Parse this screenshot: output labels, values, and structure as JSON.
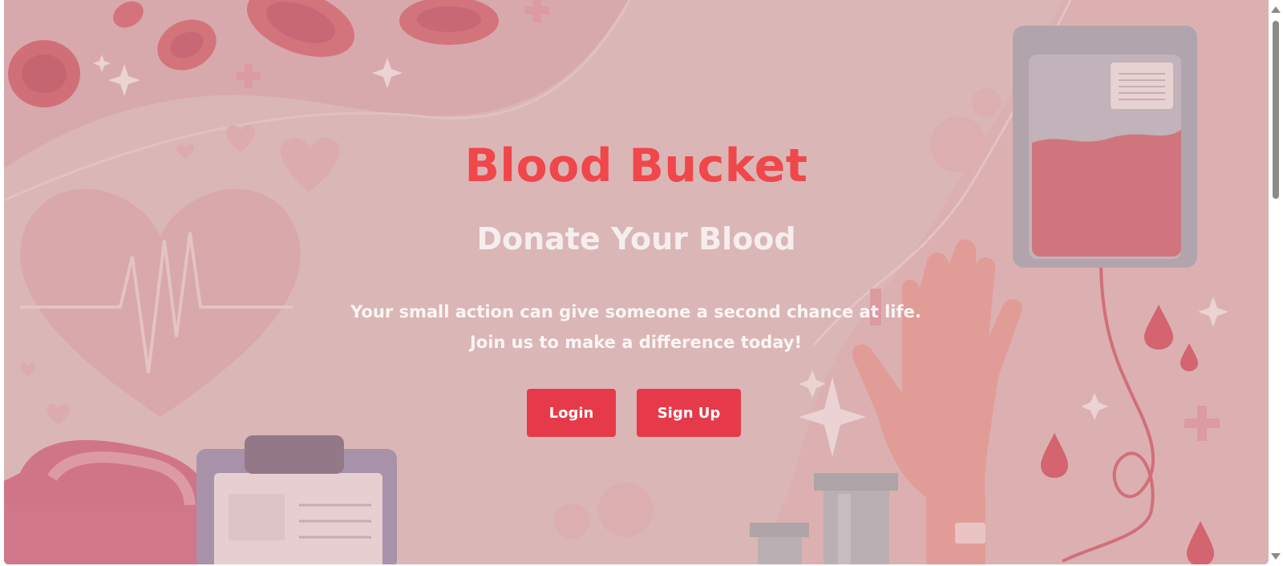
{
  "hero": {
    "title": "Blood Bucket",
    "subtitle": "Donate Your Blood",
    "tagline": "Your small action can give someone a second chance at life. Join us to make a difference today!"
  },
  "actions": {
    "login_label": "Login",
    "signup_label": "Sign Up"
  },
  "colors": {
    "title": "#f0474a",
    "button": "#e63a4a",
    "background": "#d9b3b3"
  },
  "background_illustration": [
    "blood-cells",
    "heartbeat-heart",
    "blood-bag",
    "raised-hand",
    "first-aid-kit",
    "clipboard",
    "test-tubes",
    "blood-drops",
    "hearts",
    "sparkles",
    "plus-signs"
  ]
}
